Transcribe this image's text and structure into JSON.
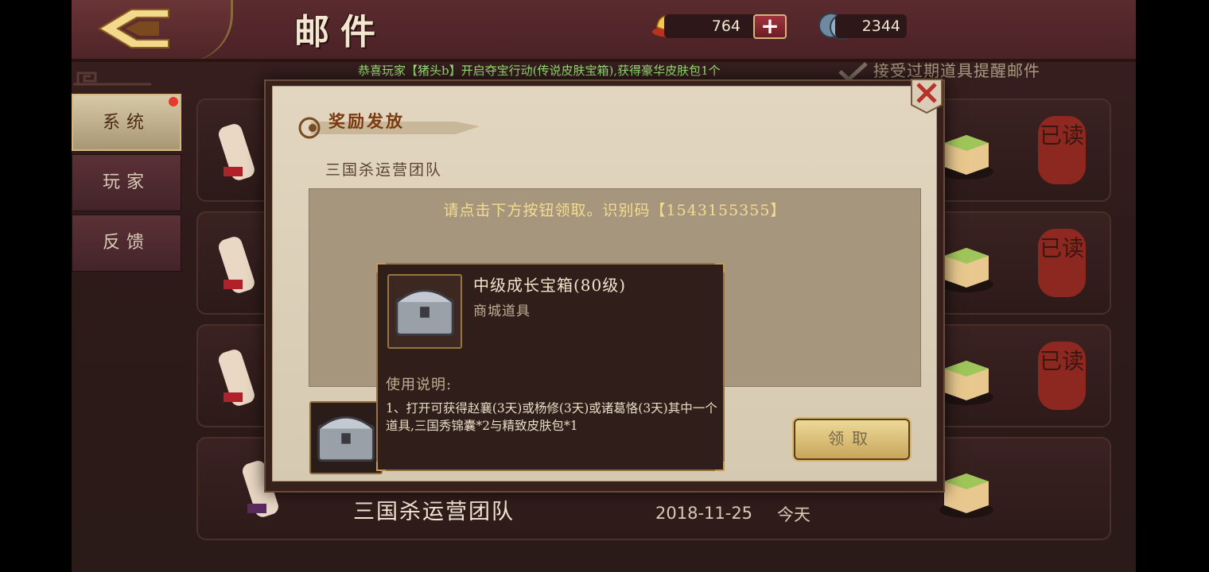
{
  "header": {
    "title": "邮件",
    "gold_amount": "764",
    "silver_amount": "2344",
    "plus_label": "+"
  },
  "marquee": {
    "text": "恭喜玩家【猪头b】开启夺宝行动(传说皮肤宝箱),获得豪华皮肤包1个"
  },
  "expire_option": {
    "label": "接受过期道具提醒邮件"
  },
  "tabs": [
    {
      "label": "系统"
    },
    {
      "label": "玩家"
    },
    {
      "label": "反馈"
    }
  ],
  "mails": [
    {
      "status": "已读"
    },
    {
      "status": "已读"
    },
    {
      "status": "已读"
    },
    {
      "from": "三国杀运营团队",
      "date": "2018-11-25",
      "when": "今天"
    }
  ],
  "dialog": {
    "title": "奖励发放",
    "sender": "三国杀运营团队",
    "message": "请点击下方按钮领取。识别码【1543155355】",
    "claim_label": "领取"
  },
  "tooltip": {
    "item_name": "中级成长宝箱(80级)",
    "item_type": "商城道具",
    "usage_heading": "使用说明:",
    "usage_text": "1、打开可获得赵襄(3天)或杨修(3天)或诸葛恪(3天)其中一个道具,三国秀锦囊*2与精致皮肤包*1"
  },
  "colors": {
    "background": "#2e1b19",
    "header": "#4a2226",
    "dialog_paper": "#ddd1ba",
    "gold_text": "#f4dc8f",
    "marquee_green": "#9fe87a",
    "stamp_red": "#9a2a22",
    "claim_button": "#d8bd76"
  }
}
